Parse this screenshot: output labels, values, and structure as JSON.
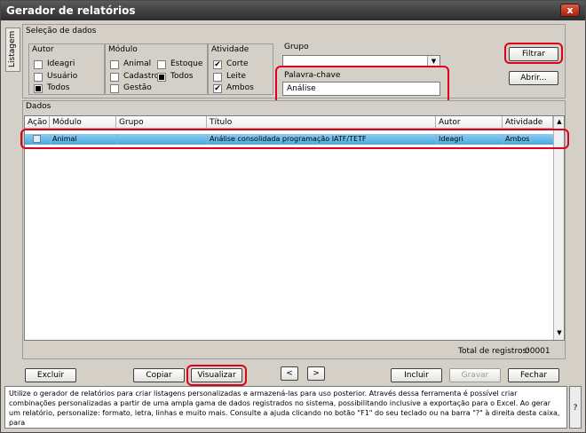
{
  "window": {
    "title": "Gerador de relatórios",
    "close_label": "x"
  },
  "side_tab": {
    "label": "Listagem"
  },
  "selecao": {
    "title": "Seleção de dados",
    "autor": {
      "label": "Autor",
      "options": [
        "Ideagri",
        "Usuário",
        "Todos"
      ]
    },
    "modulo": {
      "label": "Módulo",
      "options": [
        "Animal",
        "Cadastro",
        "Gestão",
        "Estoque",
        "Todos"
      ]
    },
    "atividade": {
      "label": "Atividade",
      "options": [
        "Corte",
        "Leite",
        "Ambos"
      ]
    },
    "grupo": {
      "label": "Grupo",
      "value": ""
    },
    "palavra": {
      "label": "Palavra-chave",
      "value": "Análise"
    },
    "filtrar_label": "Filtrar",
    "abrir_label": "Abrir..."
  },
  "dados": {
    "title": "Dados",
    "columns": [
      "Ação",
      "Módulo",
      "Grupo",
      "Título",
      "Autor",
      "Atividade"
    ],
    "rows": [
      {
        "modulo": "Animal",
        "grupo": "",
        "titulo": "Análise consolidada programação IATF/TETF",
        "autor": "Ideagri",
        "atividade": "Ambos"
      }
    ],
    "total_label": "Total de registros:",
    "total_value": "00001"
  },
  "buttons": {
    "excluir": "Excluir",
    "copiar": "Copiar",
    "visualizar": "Visualizar",
    "prev": "<",
    "next": ">",
    "incluir": "Incluir",
    "gravar": "Gravar",
    "fechar": "Fechar"
  },
  "help": {
    "text": "Utilize o gerador de relatórios para criar listagens personalizadas e armazená-las para uso posterior. Através dessa ferramenta é possível criar combinações personalizadas a partir de uma ampla gama de dados registrados no sistema, possibilitando inclusive a exportação para o Excel. Ao gerar um relatório, personalize: formato, letra, linhas e muito mais. Consulte a ajuda clicando no botão \"F1\" do seu teclado ou na barra \"?\" à direita desta caixa, para",
    "question": "?"
  },
  "colors": {
    "highlight": "#e0001a",
    "row_selected": "#4aa8e0"
  }
}
